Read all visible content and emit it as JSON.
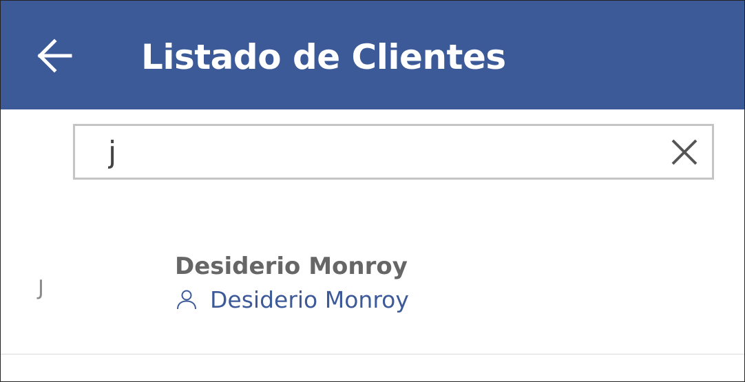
{
  "header": {
    "title": "Listado de Clientes",
    "back_icon": "arrow-left-icon",
    "background_color": "#3c5998"
  },
  "search": {
    "value": "j",
    "clear_icon": "close-icon"
  },
  "results": {
    "section_letter": "J",
    "items": [
      {
        "name": "Desiderio Monroy",
        "contact_icon": "person-icon",
        "contact_name": "Desiderio Monroy"
      }
    ]
  },
  "colors": {
    "accent": "#3c5998",
    "title_text": "#ffffff",
    "item_title": "#666666",
    "search_border": "#c4c4c4"
  }
}
